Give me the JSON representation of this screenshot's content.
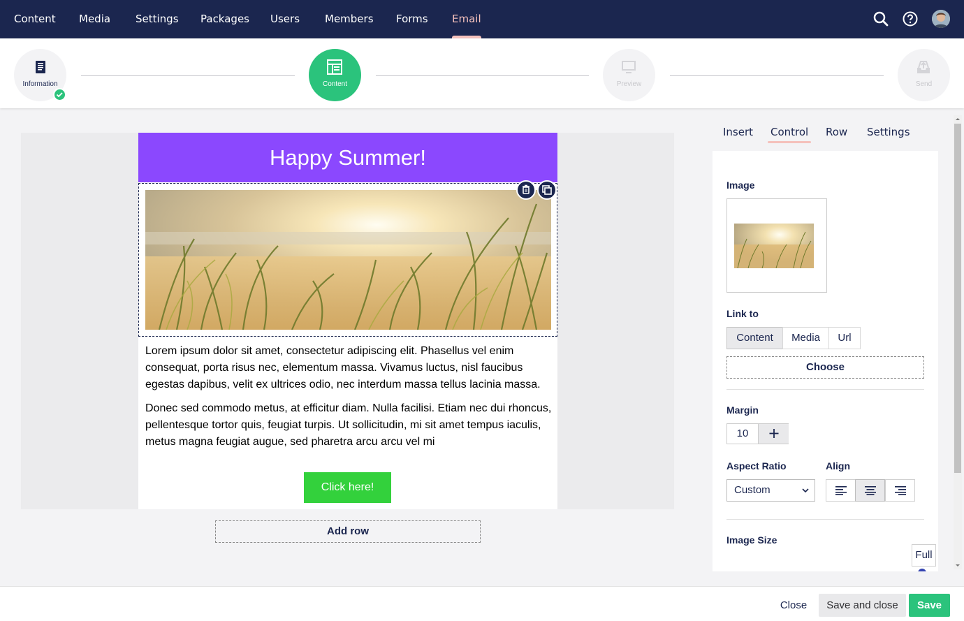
{
  "nav": {
    "items": [
      "Content",
      "Media",
      "Settings",
      "Packages",
      "Users",
      "Members",
      "Forms",
      "Email"
    ],
    "active": "Email"
  },
  "stepper": {
    "steps": [
      {
        "label": "Information",
        "state": "done"
      },
      {
        "label": "Content",
        "state": "active"
      },
      {
        "label": "Preview",
        "state": "disabled"
      },
      {
        "label": "Send",
        "state": "disabled"
      }
    ]
  },
  "email": {
    "header": "Happy Summer!",
    "paragraph1": "Lorem ipsum dolor sit amet, consectetur adipiscing elit. Phasellus vel enim consequat, porta risus nec, elementum massa. Vivamus luctus, nisl faucibus egestas dapibus, velit ex ultrices odio, nec interdum massa tellus lacinia massa.",
    "paragraph2": "Donec sed commodo metus, at efficitur diam. Nulla facilisi. Etiam nec dui rhoncus, pellentesque tortor quis, feugiat turpis. Ut sollicitudin, mi sit amet tempus iaculis, metus magna feugiat augue, sed pharetra arcu arcu vel mi",
    "cta": "Click here!",
    "add_row": "Add row"
  },
  "panel": {
    "tabs": [
      "Insert",
      "Control",
      "Row",
      "Settings"
    ],
    "active_tab": "Control",
    "image_label": "Image",
    "link_to_label": "Link to",
    "link_options": [
      "Content",
      "Media",
      "Url"
    ],
    "link_selected": "Content",
    "choose": "Choose",
    "margin_label": "Margin",
    "margin_value": "10",
    "aspect_ratio_label": "Aspect Ratio",
    "aspect_ratio_value": "Custom",
    "align_label": "Align",
    "align_selected": "center",
    "image_size_label": "Image Size",
    "full_button": "Full"
  },
  "footer": {
    "close": "Close",
    "save_and_close": "Save and close",
    "save": "Save"
  },
  "colors": {
    "nav_bg": "#1b264f",
    "accent_pink": "#f5c1bc",
    "green": "#2bc37c",
    "email_header": "#8b48fe",
    "cta_green": "#33d13c"
  }
}
